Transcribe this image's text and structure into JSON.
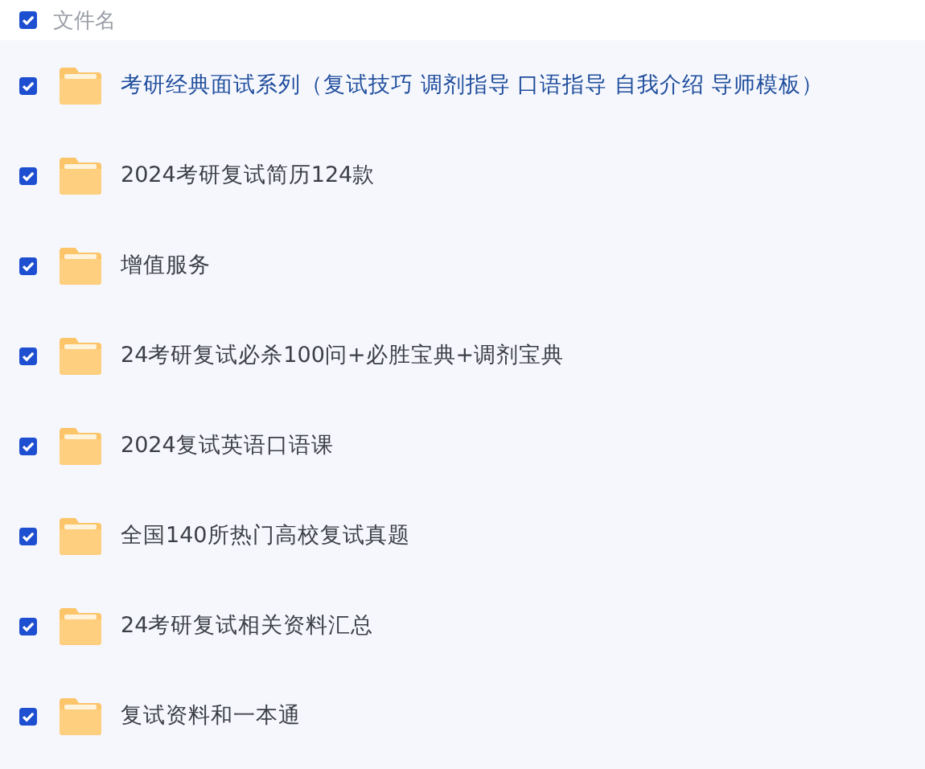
{
  "header": {
    "label": "文件名",
    "checked": true
  },
  "files": [
    {
      "name": "考研经典面试系列（复试技巧 调剂指导 口语指导 自我介绍 导师模板）",
      "checked": true,
      "hovered": true
    },
    {
      "name": "2024考研复试简历124款",
      "checked": true,
      "hovered": false
    },
    {
      "name": "增值服务",
      "checked": true,
      "hovered": false
    },
    {
      "name": "24考研复试必杀100问+必胜宝典+调剂宝典",
      "checked": true,
      "hovered": false
    },
    {
      "name": "2024复试英语口语课",
      "checked": true,
      "hovered": false
    },
    {
      "name": "全国140所热门高校复试真题",
      "checked": true,
      "hovered": false
    },
    {
      "name": "24考研复试相关资料汇总",
      "checked": true,
      "hovered": false
    },
    {
      "name": "复试资料和一本通",
      "checked": true,
      "hovered": false
    }
  ]
}
